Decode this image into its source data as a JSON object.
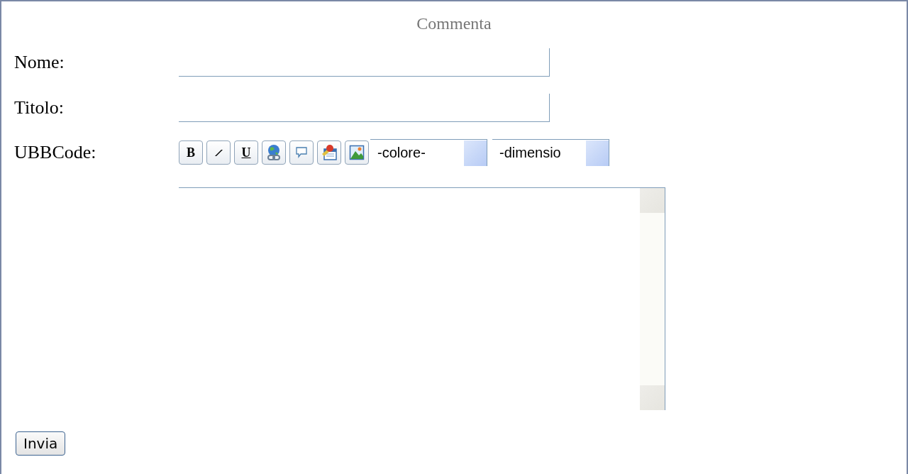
{
  "title": "Commenta",
  "fields": [
    {
      "label": "Nome:"
    },
    {
      "label": "Titolo:"
    }
  ],
  "ubbcode": {
    "label": "UBBCode:",
    "tools": [
      {
        "kind": "bold",
        "text": "B"
      },
      {
        "kind": "italic"
      },
      {
        "kind": "underline",
        "text": "U"
      },
      {
        "kind": "link"
      },
      {
        "kind": "quote"
      },
      {
        "kind": "note"
      },
      {
        "kind": "image"
      }
    ],
    "selects": [
      {
        "value": "-colore-"
      },
      {
        "value": "-dimensio"
      }
    ]
  },
  "submit": "Invia"
}
